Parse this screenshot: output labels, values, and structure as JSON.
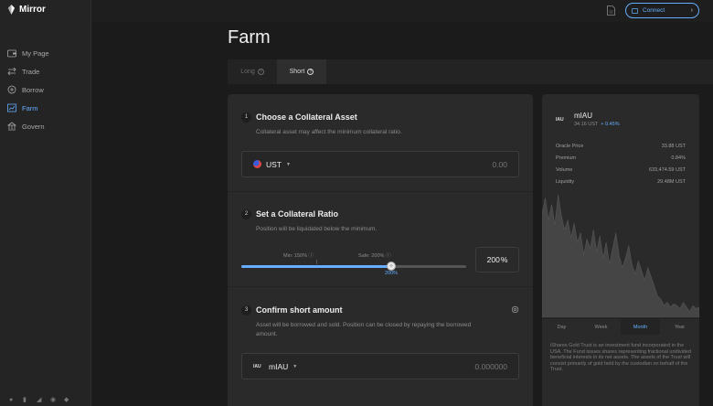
{
  "app": {
    "logo_text": "Mirror"
  },
  "sidebar": {
    "items": [
      {
        "label": "My Page",
        "icon": "wallet-icon",
        "active": false
      },
      {
        "label": "Trade",
        "icon": "swap-icon",
        "active": false
      },
      {
        "label": "Borrow",
        "icon": "borrow-icon",
        "active": false
      },
      {
        "label": "Farm",
        "icon": "chart-icon",
        "active": true
      },
      {
        "label": "Govern",
        "icon": "govern-icon",
        "active": false
      }
    ],
    "socials": [
      "github-icon",
      "medium-icon",
      "telegram-icon",
      "discord-icon",
      "twitter-icon"
    ]
  },
  "header": {
    "connect_label": "Connect"
  },
  "page": {
    "title": "Farm"
  },
  "tabs": [
    {
      "label": "Long",
      "active": false
    },
    {
      "label": "Short",
      "active": true
    }
  ],
  "step1": {
    "num": "1",
    "title": "Choose a Collateral Asset",
    "desc": "Collateral asset may affect the minimum collateral ratio.",
    "asset": "UST",
    "placeholder": "0.00"
  },
  "step2": {
    "num": "2",
    "title": "Set a Collateral Ratio",
    "desc": "Position will be liquidated below the minimum.",
    "min_label": "Min: 150%",
    "safe_label": "Safe: 200%",
    "current_label": "200%",
    "ratio_value": "200",
    "ratio_unit": "%",
    "slider": {
      "min": 100,
      "max": 250,
      "min_mark": 150,
      "safe_mark": 200,
      "value": 200
    }
  },
  "step3": {
    "num": "3",
    "title": "Confirm short amount",
    "desc": "Asset will be borrowed and sold. Position can be closed by repaying the borrowed amount.",
    "asset": "mIAU",
    "asset_logo": "IAU",
    "placeholder": "0.000000"
  },
  "side": {
    "logo": "IAU",
    "name": "mIAU",
    "price": "34.16 UST",
    "change": "+ 0.45%",
    "stats": [
      {
        "label": "Oracle Price",
        "value": "33.88 UST"
      },
      {
        "label": "Premium",
        "value": "0.84%"
      },
      {
        "label": "Volume",
        "value": "633,474.59 UST"
      },
      {
        "label": "Liquidity",
        "value": "29.48M UST"
      }
    ],
    "ranges": [
      {
        "label": "Day",
        "active": false
      },
      {
        "label": "Week",
        "active": false
      },
      {
        "label": "Month",
        "active": true
      },
      {
        "label": "Year",
        "active": false
      }
    ],
    "description": "iShares Gold Trust is an investment fund incorporated in the USA. The Fund issues shares representing fractional undivided beneficial interests in its net assets. The assets of the Trust will consist primarily of gold held by the custodian on behalf of the Trust.",
    "chart_series": [
      62,
      72,
      58,
      68,
      55,
      74,
      61,
      52,
      58,
      47,
      56,
      44,
      50,
      36,
      46,
      40,
      52,
      38,
      48,
      34,
      44,
      30,
      40,
      50,
      36,
      28,
      34,
      42,
      30,
      24,
      32,
      26,
      20,
      28,
      22,
      16,
      10,
      8,
      4,
      6,
      3,
      5,
      4,
      2,
      6,
      3,
      0,
      4,
      2,
      3
    ]
  }
}
